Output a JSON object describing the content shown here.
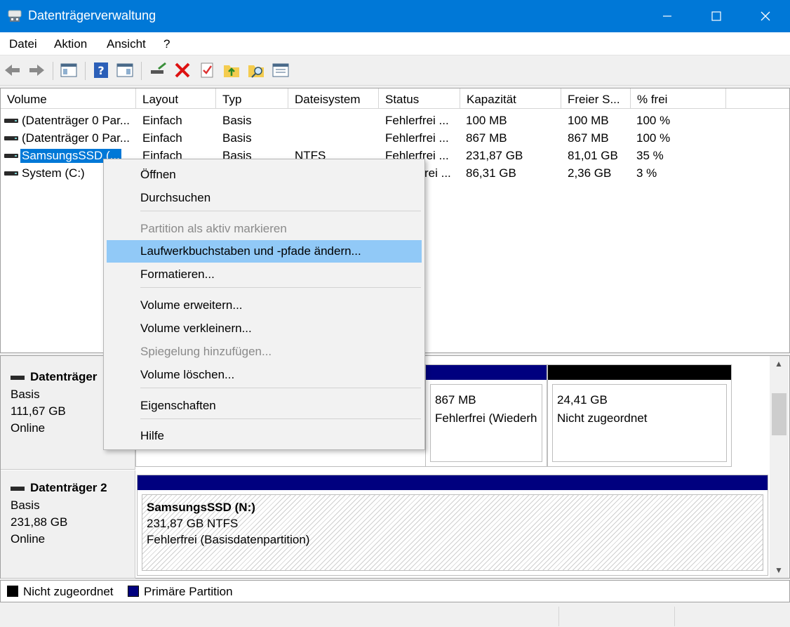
{
  "window": {
    "title": "Datenträgerverwaltung",
    "minimize_icon": "minimize-icon",
    "maximize_icon": "maximize-icon",
    "close_icon": "close-icon"
  },
  "menubar": [
    "Datei",
    "Aktion",
    "Ansicht",
    "?"
  ],
  "toolbar": [
    "back-icon",
    "forward-icon",
    "console-tree-icon",
    "help-icon",
    "action-pane-icon",
    "connect-disk-icon",
    "delete-icon",
    "check-properties-icon",
    "folder-up-icon",
    "folder-search-icon",
    "settings-list-icon"
  ],
  "columns": [
    "Volume",
    "Layout",
    "Typ",
    "Dateisystem",
    "Status",
    "Kapazität",
    "Freier S...",
    "% frei"
  ],
  "volumes": [
    {
      "name": "(Datenträger 0 Par...",
      "layout": "Einfach",
      "type": "Basis",
      "fs": "",
      "status": "Fehlerfrei ...",
      "capacity": "100 MB",
      "free": "100 MB",
      "pct": "100 %"
    },
    {
      "name": "(Datenträger 0 Par...",
      "layout": "Einfach",
      "type": "Basis",
      "fs": "",
      "status": "Fehlerfrei ...",
      "capacity": "867 MB",
      "free": "867 MB",
      "pct": "100 %"
    },
    {
      "name": "SamsungsSSD (...",
      "layout": "Einfach",
      "type": "Basis",
      "fs": "NTFS",
      "status": "Fehlerfrei ...",
      "capacity": "231,87 GB",
      "free": "81,01 GB",
      "pct": "35 %"
    },
    {
      "name": "System (C:)",
      "layout": "",
      "type": "",
      "fs": "",
      "status": "rei ...",
      "capacity": "86,31 GB",
      "free": "2,36 GB",
      "pct": "3 %"
    }
  ],
  "context_menu": {
    "items": [
      {
        "label": "Öffnen",
        "state": "normal"
      },
      {
        "label": "Durchsuchen",
        "state": "normal"
      },
      {
        "label": "Partition als aktiv markieren",
        "state": "disabled"
      },
      {
        "label": "Laufwerkbuchstaben und -pfade ändern...",
        "state": "highlighted"
      },
      {
        "label": "Formatieren...",
        "state": "normal"
      },
      {
        "label": "Volume erweitern...",
        "state": "normal"
      },
      {
        "label": "Volume verkleinern...",
        "state": "normal"
      },
      {
        "label": "Spiegelung hinzufügen...",
        "state": "disabled"
      },
      {
        "label": "Volume löschen...",
        "state": "normal"
      },
      {
        "label": "Eigenschaften",
        "state": "normal"
      },
      {
        "label": "Hilfe",
        "state": "normal"
      }
    ]
  },
  "disks": [
    {
      "header": "Datenträger",
      "type": "Basis",
      "size": "111,67 GB",
      "state": "Online",
      "partitions": [
        {
          "size": "867 MB",
          "status": "Fehlerfrei (Wiederh",
          "bar": "#00007f"
        },
        {
          "size": "24,41 GB",
          "status": "Nicht zugeordnet",
          "bar": "#000000"
        }
      ]
    },
    {
      "header": "Datenträger 2",
      "type": "Basis",
      "size": "231,88 GB",
      "state": "Online",
      "partitions": [
        {
          "title": "SamsungsSSD  (N:)",
          "size": "231,87 GB NTFS",
          "status": "Fehlerfrei (Basisdatenpartition)",
          "bar": "#00007f"
        }
      ]
    }
  ],
  "legend": [
    {
      "label": "Nicht zugeordnet",
      "color": "#000000"
    },
    {
      "label": "Primäre Partition",
      "color": "#00007f"
    }
  ],
  "colors": {
    "titlebar": "#0078d7",
    "primary": "#00007f",
    "unallocated": "#000000",
    "highlight": "#91c9f7"
  }
}
